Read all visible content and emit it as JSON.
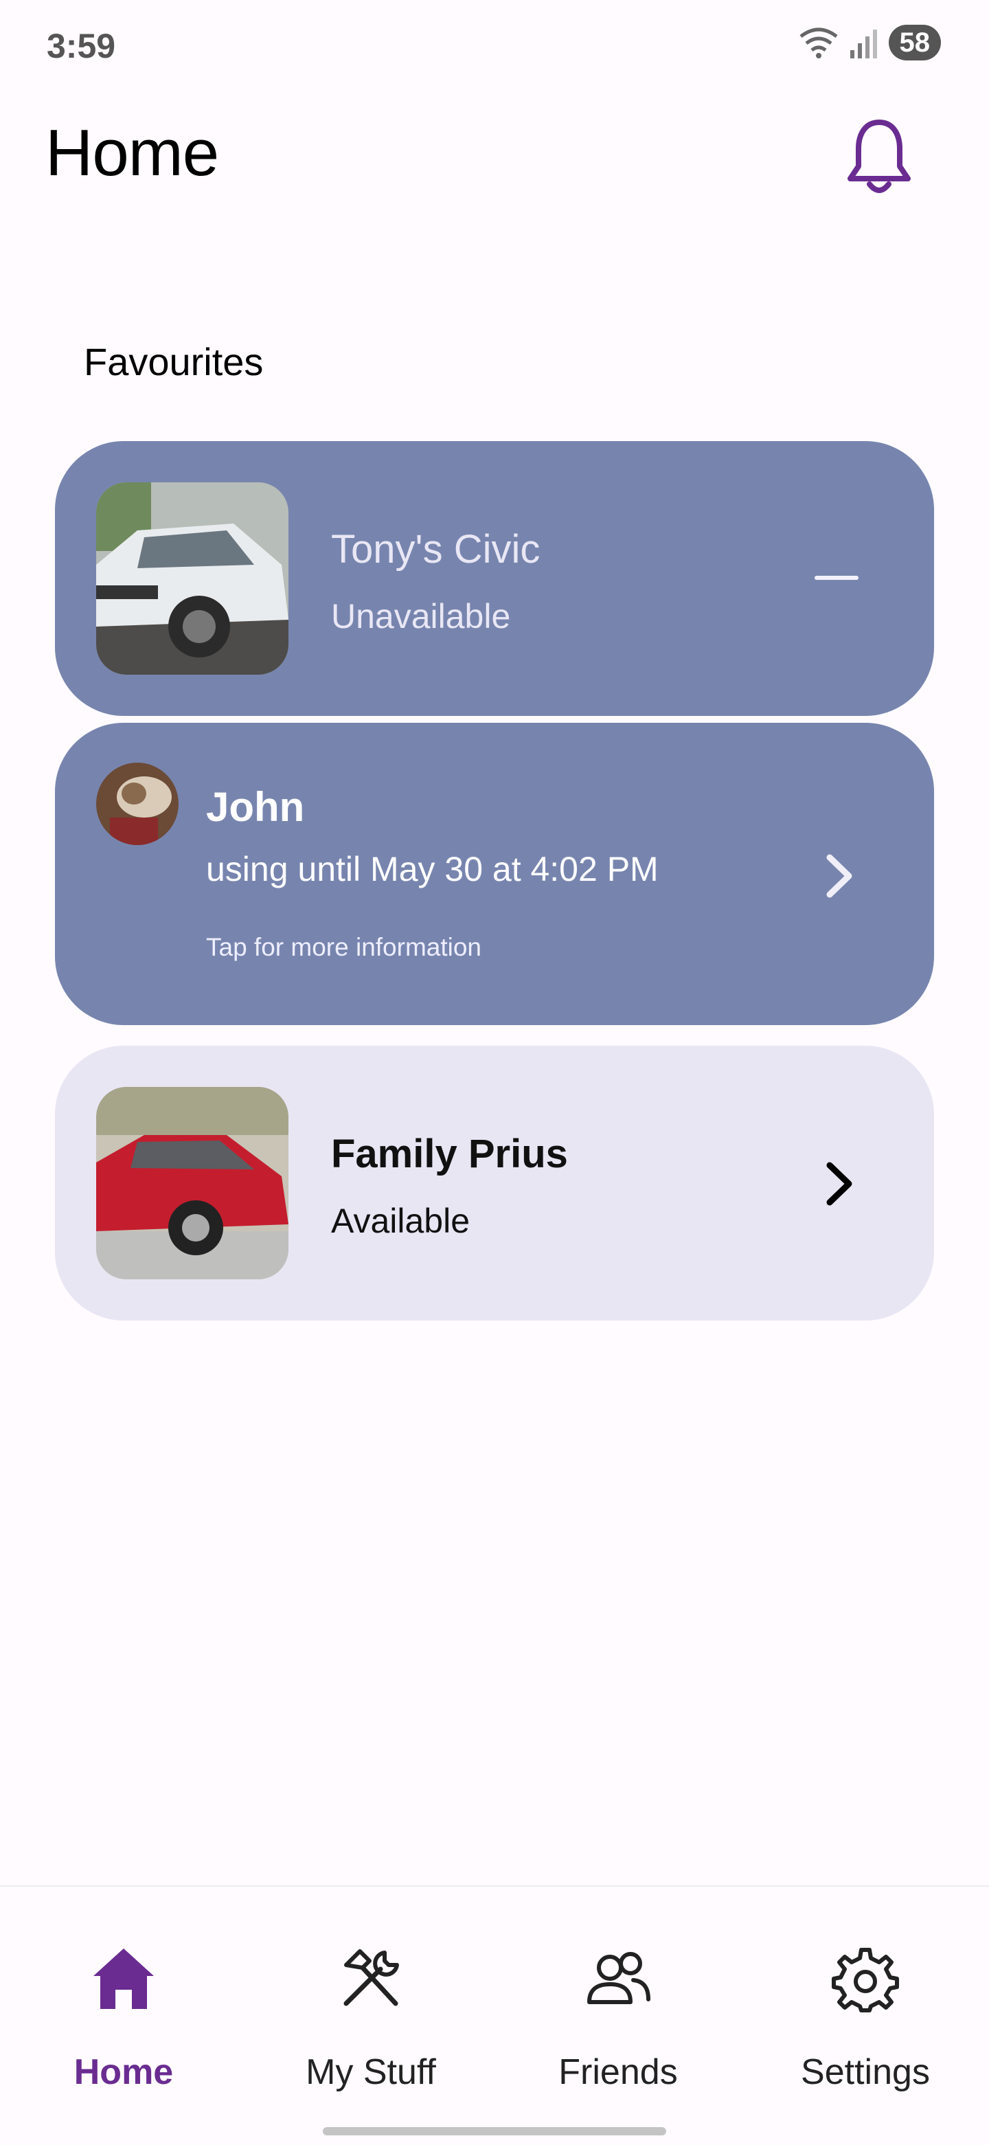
{
  "status_bar": {
    "time": "3:59",
    "battery": "58"
  },
  "header": {
    "title": "Home"
  },
  "favourites": {
    "label": "Favourites",
    "items": [
      {
        "title": "Tony's Civic",
        "status": "Unavailable"
      },
      {
        "name": "John",
        "status": "using until May 30 at 4:02 PM",
        "hint": "Tap for more information"
      },
      {
        "title": "Family Prius",
        "status": "Available"
      }
    ]
  },
  "nav": {
    "items": [
      {
        "label": "Home",
        "icon": "home-icon",
        "active": true
      },
      {
        "label": "My Stuff",
        "icon": "tools-icon",
        "active": false
      },
      {
        "label": "Friends",
        "icon": "friends-icon",
        "active": false
      },
      {
        "label": "Settings",
        "icon": "gear-icon",
        "active": false
      }
    ]
  },
  "colors": {
    "accent": "#6a2c91",
    "card_dark": "#7785ae",
    "card_light": "#e9e6f4"
  }
}
